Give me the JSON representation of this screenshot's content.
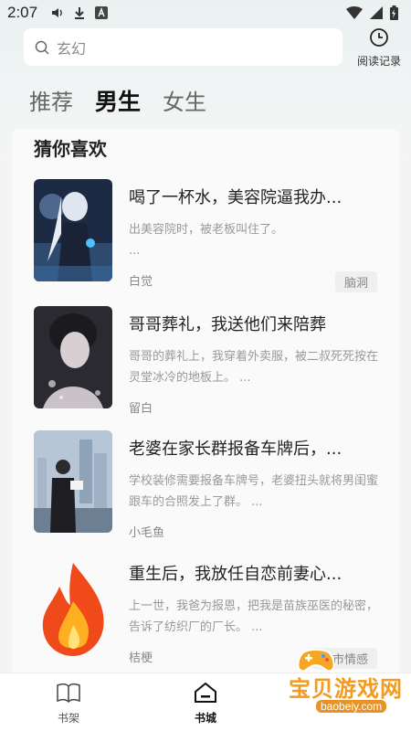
{
  "status_bar": {
    "time": "2:07"
  },
  "search": {
    "placeholder": "玄幻"
  },
  "history": {
    "label": "阅读记录"
  },
  "tabs": [
    {
      "label": "推荐",
      "active": false
    },
    {
      "label": "男生",
      "active": true
    },
    {
      "label": "女生",
      "active": false
    }
  ],
  "section": {
    "title": "猜你喜欢"
  },
  "books": [
    {
      "title": "喝了一杯水，美容院逼我办...",
      "desc": "出美容院时，被老板叫住了。\n...",
      "author": "白觉",
      "tag": "脑洞"
    },
    {
      "title": "哥哥葬礼，我送他们来陪葬",
      "desc": "哥哥的葬礼上，我穿着外卖服，被二叔死死按在灵堂冰冷的地板上。 ...",
      "author": "留白",
      "tag": ""
    },
    {
      "title": "老婆在家长群报备车牌后，...",
      "desc": "学校装修需要报备车牌号，老婆扭头就将男闺蜜跟车的合照发上了群。 ...",
      "author": "小毛鱼",
      "tag": ""
    },
    {
      "title": "重生后，我放任自恋前妻心...",
      "desc": "上一世，我爸为报恩，把我是苗族巫医的秘密，告诉了纺织厂的厂长。 ...",
      "author": "桔梗",
      "tag": "都市情感"
    }
  ],
  "bottom_nav": [
    {
      "label": "书架",
      "icon": "book-open-icon",
      "active": false
    },
    {
      "label": "书城",
      "icon": "home-icon",
      "active": true
    }
  ],
  "watermark": {
    "text": "宝贝游戏网",
    "url": "baobeiy.com"
  }
}
